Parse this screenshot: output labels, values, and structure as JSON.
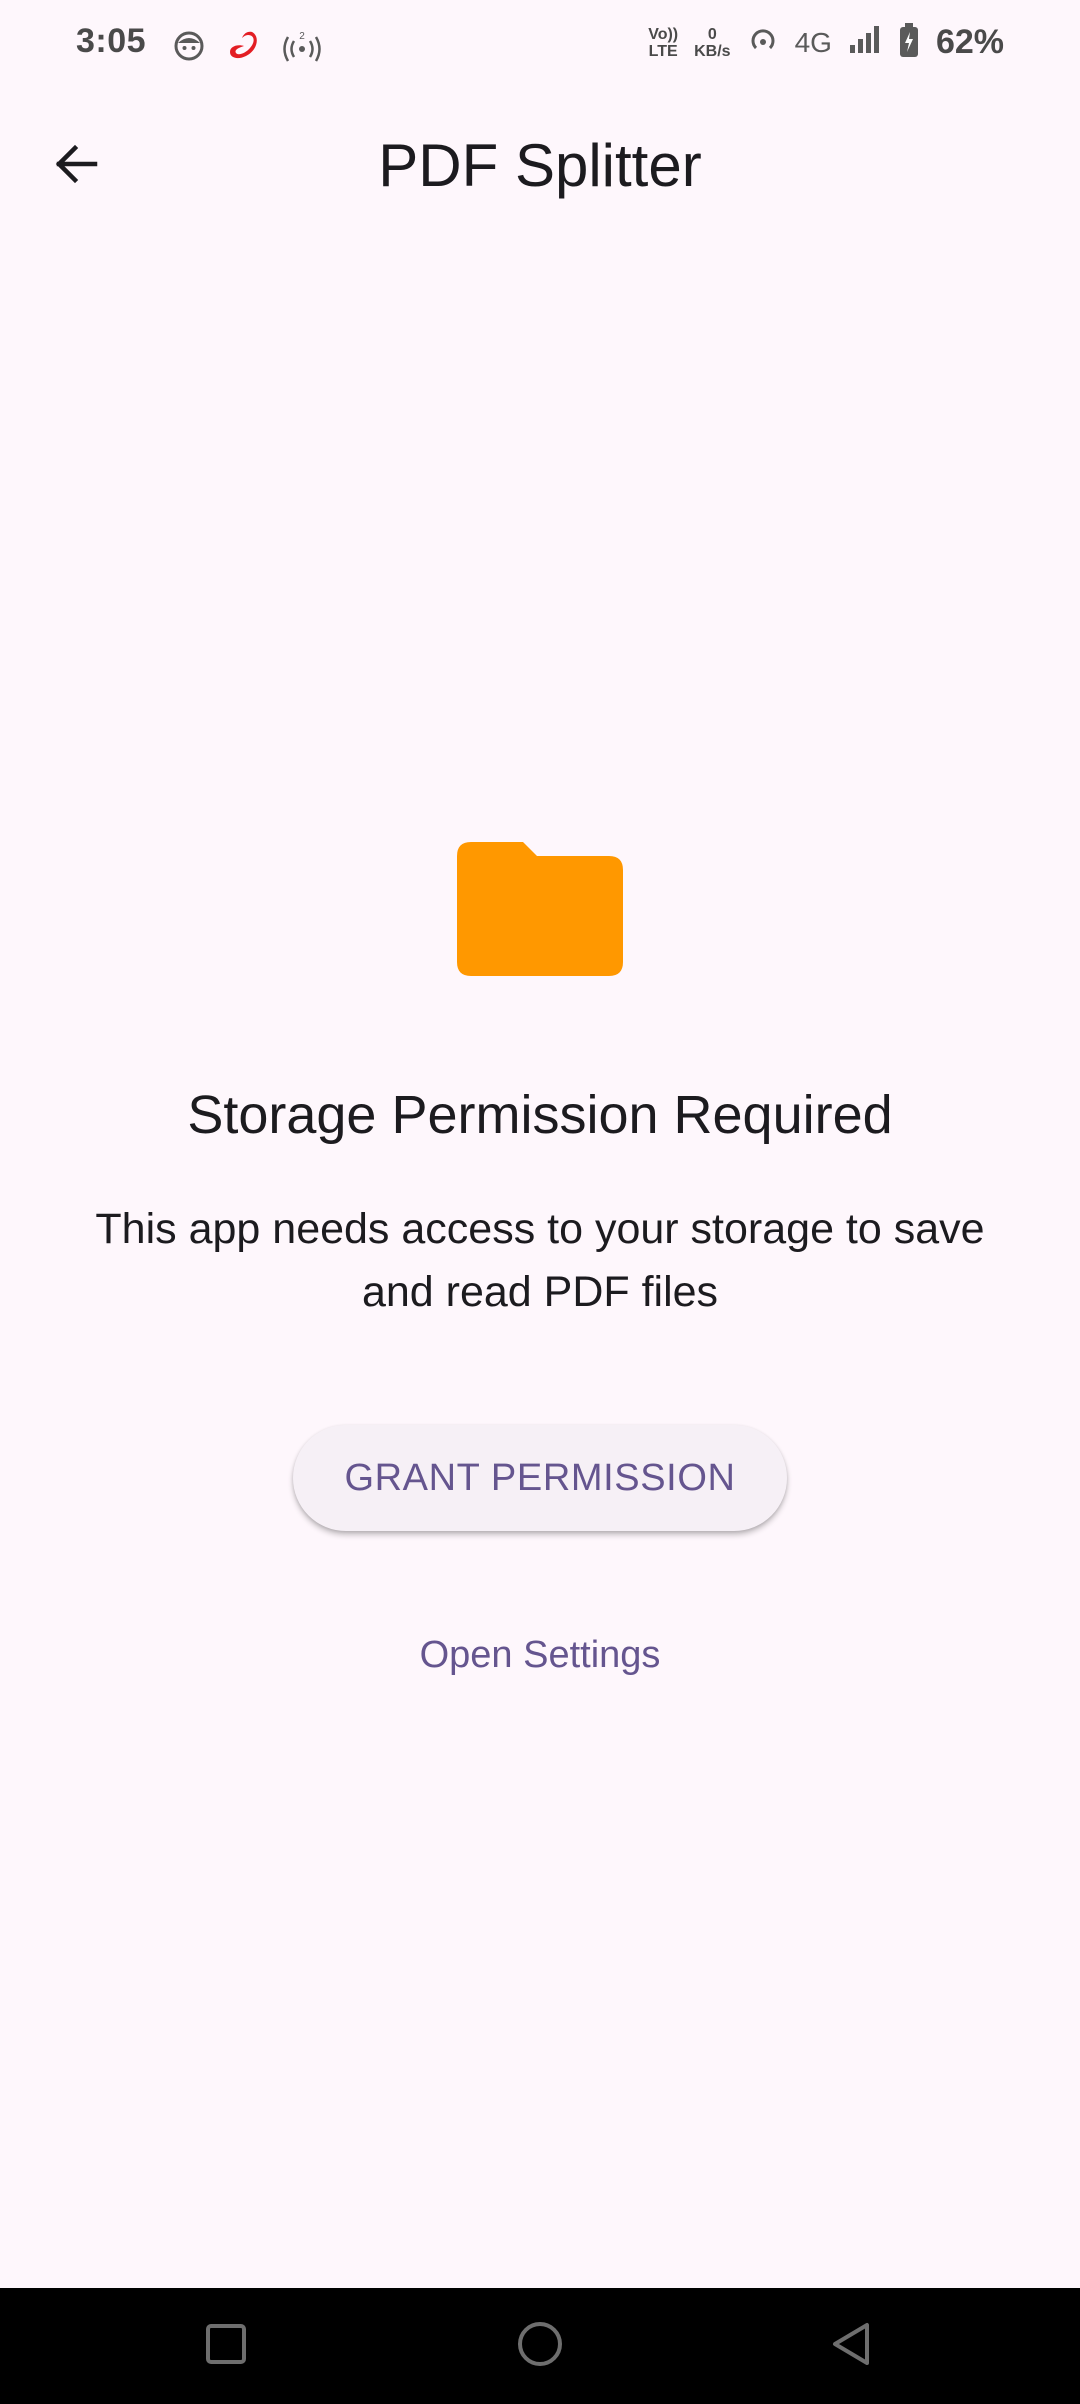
{
  "status_bar": {
    "time": "3:05",
    "volte_top": "Vo))",
    "volte_bottom": "LTE",
    "speed_value": "0",
    "speed_unit": "KB/s",
    "network": "4G",
    "battery": "62%",
    "icons": [
      "face-icon",
      "airtel-icon",
      "signal-broadcast-icon",
      "hotspot-icon",
      "signal-bars-icon",
      "battery-icon"
    ]
  },
  "app_bar": {
    "title": "PDF Splitter",
    "back_icon": "arrow-back-icon"
  },
  "permission": {
    "icon": "folder-icon",
    "icon_color": "#FF9800",
    "title": "Storage Permission Required",
    "description": "This app needs access to your storage to save and read PDF files",
    "grant_label": "GRANT PERMISSION",
    "settings_label": "Open Settings",
    "accent_color": "#65558F"
  },
  "nav_bar": {
    "buttons": [
      "recents-icon",
      "home-icon",
      "back-icon"
    ]
  }
}
